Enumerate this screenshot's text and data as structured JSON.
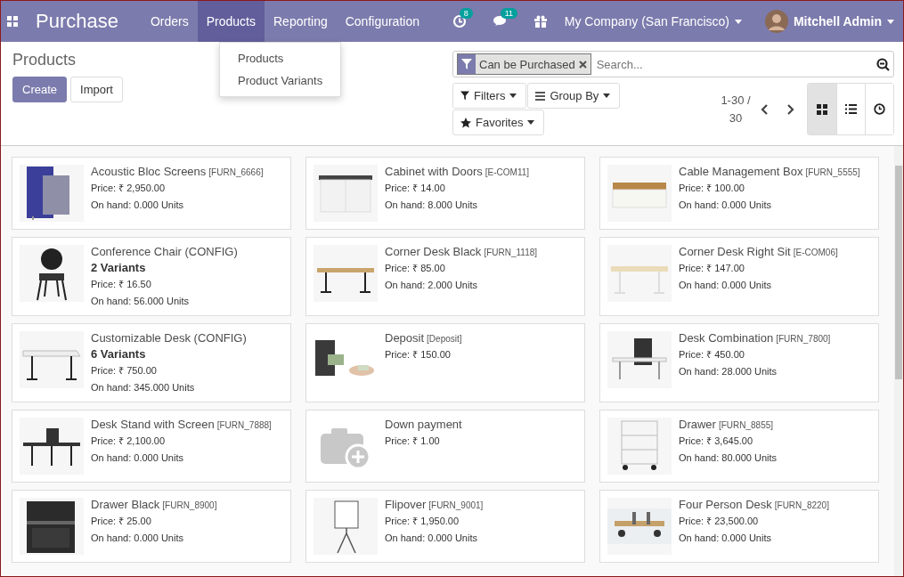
{
  "navbar": {
    "app_title": "Purchase",
    "menu": [
      {
        "label": "Orders",
        "selected": false
      },
      {
        "label": "Products",
        "selected": true
      },
      {
        "label": "Reporting",
        "selected": false
      },
      {
        "label": "Configuration",
        "selected": false
      }
    ],
    "activity_count": "8",
    "message_count": "11",
    "company": "My Company (San Francisco)",
    "user": "Mitchell Admin"
  },
  "dropdown": {
    "items": [
      "Products",
      "Product Variants"
    ]
  },
  "control_panel": {
    "breadcrumb": "Products",
    "buttons": [
      "Create",
      "Import"
    ],
    "search": {
      "facet": "Can be Purchased",
      "placeholder": "Search..."
    },
    "filters": [
      "Filters",
      "Group By",
      "Favorites"
    ],
    "pager": "1-30 / 30",
    "views": [
      {
        "kind": "kanban",
        "selected": true
      },
      {
        "kind": "list",
        "selected": false
      },
      {
        "kind": "activity",
        "selected": false
      }
    ]
  },
  "products": [
    {
      "name": "Acoustic Bloc Screens",
      "ref": "[FURN_6666]",
      "price": "Price: ₹ 2,950.00",
      "on_hand": "On hand: 0.000 Units"
    },
    {
      "name": "Cabinet with Doors",
      "ref": "[E-COM11]",
      "price": "Price: ₹ 14.00",
      "on_hand": "On hand: 8.000 Units"
    },
    {
      "name": "Cable Management Box",
      "ref": "[FURN_5555]",
      "price": "Price: ₹ 100.00",
      "on_hand": "On hand: 0.000 Units"
    },
    {
      "name": "Conference Chair (CONFIG)",
      "variants": "2 Variants",
      "price": "Price: ₹ 16.50",
      "on_hand": "On hand: 56.000 Units"
    },
    {
      "name": "Corner Desk Black",
      "ref": "[FURN_1118]",
      "price": "Price: ₹ 85.00",
      "on_hand": "On hand: 2.000 Units"
    },
    {
      "name": "Corner Desk Right Sit",
      "ref": "[E-COM06]",
      "price": "Price: ₹ 147.00",
      "on_hand": "On hand: 0.000 Units"
    },
    {
      "name": "Customizable Desk (CONFIG)",
      "variants": "6 Variants",
      "price": "Price: ₹ 750.00",
      "on_hand": "On hand: 345.000 Units"
    },
    {
      "name": "Deposit",
      "ref": "[Deposit]",
      "price": "Price: ₹ 150.00"
    },
    {
      "name": "Desk Combination",
      "ref": "[FURN_7800]",
      "price": "Price: ₹ 450.00",
      "on_hand": "On hand: 28.000 Units"
    },
    {
      "name": "Desk Stand with Screen",
      "ref": "[FURN_7888]",
      "price": "Price: ₹ 2,100.00",
      "on_hand": "On hand: 0.000 Units"
    },
    {
      "kind": "placeholder",
      "name": "Down payment",
      "price": "Price: ₹ 1.00"
    },
    {
      "name": "Drawer",
      "ref": "[FURN_8855]",
      "price": "Price: ₹ 3,645.00",
      "on_hand": "On hand: 80.000 Units"
    },
    {
      "name": "Drawer Black",
      "ref": "[FURN_8900]",
      "price": "Price: ₹ 25.00",
      "on_hand": "On hand: 0.000 Units"
    },
    {
      "name": "Flipover",
      "ref": "[FURN_9001]",
      "price": "Price: ₹ 1,950.00",
      "on_hand": "On hand: 0.000 Units"
    },
    {
      "name": "Four Person Desk",
      "ref": "[FURN_8220]",
      "price": "Price: ₹ 23,500.00",
      "on_hand": "On hand: 0.000 Units"
    }
  ]
}
